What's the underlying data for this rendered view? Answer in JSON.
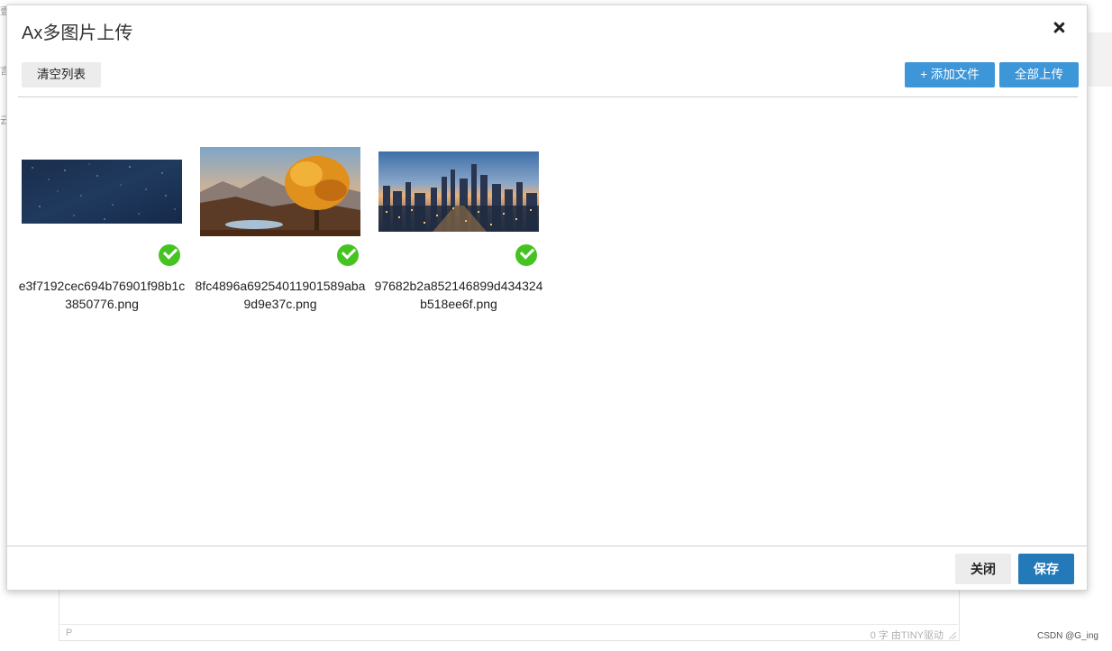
{
  "background": {
    "left_chars": [
      "壹",
      "言",
      "云"
    ],
    "status_left": "P",
    "status_right": "0 字  由TINY驱动",
    "watermark": "CSDN @G_ing"
  },
  "dialog": {
    "title": "Ax多图片上传",
    "close_label": "×",
    "toolbar": {
      "clear_label": "清空列表",
      "add_label": "+ 添加文件",
      "upload_all_label": "全部上传"
    },
    "files": [
      {
        "name": "e3f7192cec694b76901f98b1c3850776.png",
        "status": "uploaded",
        "thumb": "starry-night"
      },
      {
        "name": "8fc4896a69254011901589aba9d9e37c.png",
        "status": "uploaded",
        "thumb": "autumn-tree"
      },
      {
        "name": "97682b2a852146899d434324b518ee6f.png",
        "status": "uploaded",
        "thumb": "city-dusk"
      }
    ],
    "footer": {
      "close_label": "关闭",
      "save_label": "保存"
    }
  },
  "colors": {
    "primary": "#3c96d8",
    "save": "#2479b9",
    "success": "#45c321"
  }
}
